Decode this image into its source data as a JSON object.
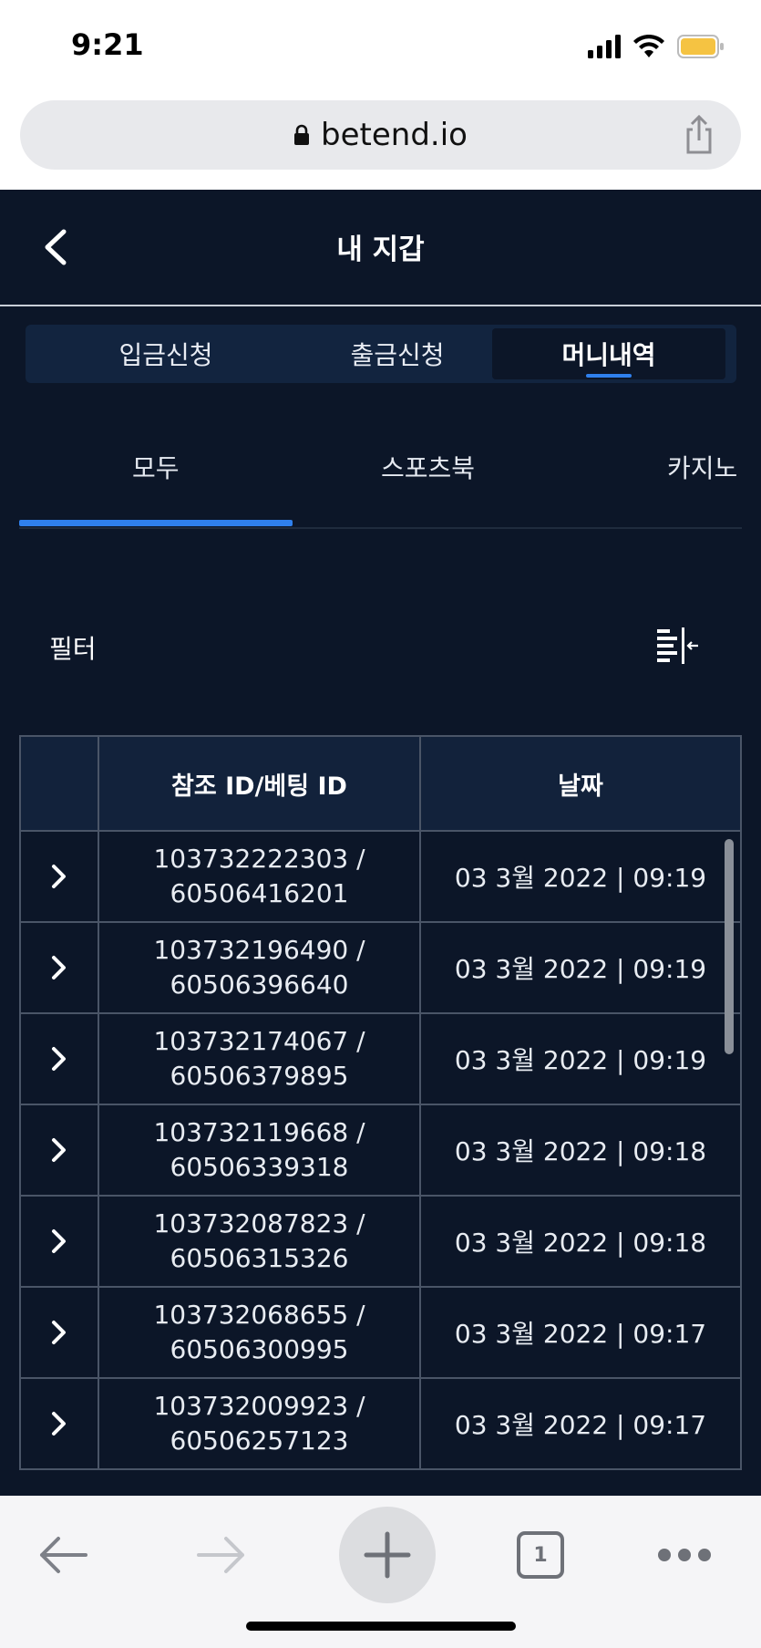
{
  "status": {
    "time": "9:21"
  },
  "browser": {
    "url": "betend.io",
    "tab_count": "1"
  },
  "header": {
    "title": "내 지갑"
  },
  "wallet_tabs": [
    {
      "label": "입금신청"
    },
    {
      "label": "출금신청"
    },
    {
      "label": "머니내역"
    }
  ],
  "sub_tabs": [
    {
      "label": "모두"
    },
    {
      "label": "스포츠북"
    },
    {
      "label": "카지노"
    }
  ],
  "filter": {
    "label": "필터"
  },
  "table": {
    "columns": [
      "",
      "참조 ID/베팅 ID",
      "날짜"
    ],
    "rows": [
      {
        "ref_id": "103732222303 /",
        "bet_id": "60506416201",
        "date": "03 3월 2022 | 09:19"
      },
      {
        "ref_id": "103732196490 /",
        "bet_id": "60506396640",
        "date": "03 3월 2022 | 09:19"
      },
      {
        "ref_id": "103732174067 /",
        "bet_id": "60506379895",
        "date": "03 3월 2022 | 09:19"
      },
      {
        "ref_id": "103732119668 /",
        "bet_id": "60506339318",
        "date": "03 3월 2022 | 09:18"
      },
      {
        "ref_id": "103732087823 /",
        "bet_id": "60506315326",
        "date": "03 3월 2022 | 09:18"
      },
      {
        "ref_id": "103732068655 /",
        "bet_id": "60506300995",
        "date": "03 3월 2022 | 09:17"
      },
      {
        "ref_id": "103732009923 /",
        "bet_id": "60506257123",
        "date": "03 3월 2022 | 09:17"
      }
    ]
  },
  "colors": {
    "app_background": "#0c1628",
    "accent": "#2f80ed",
    "header_row": "#12223b",
    "battery": "#f5c342"
  },
  "icons": {
    "status": [
      "signal-icon",
      "wifi-icon",
      "battery-icon"
    ],
    "browser": [
      "lock-icon",
      "share-icon",
      "back-arrow-icon",
      "forward-arrow-icon",
      "new-tab-plus-icon",
      "tabs-icon",
      "more-icon"
    ],
    "app": [
      "back-chevron-icon",
      "filter-sort-icon",
      "expand-chevron-icon"
    ]
  }
}
